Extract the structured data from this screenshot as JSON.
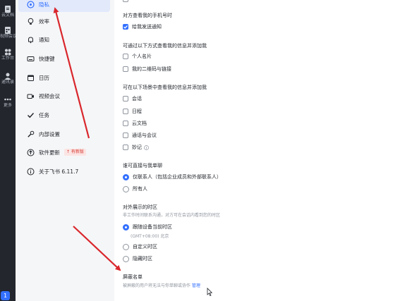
{
  "rail": {
    "items": [
      {
        "label": "云文档",
        "icon": "doc-icon"
      },
      {
        "label": "视频会议",
        "icon": "calendar-grid-icon"
      },
      {
        "label": "工作台",
        "icon": "apps-icon"
      },
      {
        "label": "通讯录",
        "icon": "contacts-icon"
      },
      {
        "label": "更多",
        "icon": "more-icon"
      }
    ],
    "badge": "1"
  },
  "nav": {
    "items": [
      {
        "label": "隐私",
        "icon": "shield-icon",
        "active": true
      },
      {
        "label": "效率",
        "icon": "bulb-icon"
      },
      {
        "label": "通知",
        "icon": "bell-icon"
      },
      {
        "label": "快捷键",
        "icon": "keyboard-icon"
      },
      {
        "label": "日历",
        "icon": "calendar-icon"
      },
      {
        "label": "视频会议",
        "icon": "video-icon"
      },
      {
        "label": "任务",
        "icon": "check-icon"
      },
      {
        "label": "内部设置",
        "icon": "wrench-icon"
      },
      {
        "label": "软件更新",
        "icon": "upload-icon",
        "badge": "↑ 有新版"
      },
      {
        "label": "关于飞书 6.11.7",
        "icon": "info-icon"
      }
    ]
  },
  "privacy": {
    "phone": {
      "title": "对方查看我的手机号时",
      "options": [
        {
          "label": "给我发送通知",
          "checked": true
        }
      ]
    },
    "find": {
      "title": "可通过以下方式查看我的信息并添加我",
      "options": [
        {
          "label": "个人名片",
          "checked": false
        },
        {
          "label": "我的二维码与链接",
          "checked": false
        }
      ]
    },
    "scenes": {
      "title": "可在以下场景中查看我的信息并添加我",
      "options": [
        {
          "label": "会话",
          "checked": false
        },
        {
          "label": "日程",
          "checked": false
        },
        {
          "label": "云文档",
          "checked": false
        },
        {
          "label": "通话与会议",
          "checked": false
        },
        {
          "label": "妙记",
          "checked": false
        }
      ]
    },
    "contact": {
      "title": "谁可直接与我单聊",
      "options": [
        {
          "label": "仅联系人（包括企业成员和外部联系人）",
          "checked": true
        },
        {
          "label": "所有人",
          "checked": false
        }
      ]
    },
    "timezone": {
      "title": "对外展示的时区",
      "subtitle": "非工作时间联系沟通，对方可在会话内看到您的时区",
      "options": [
        {
          "label": "跟随设备当前时区",
          "checked": true,
          "note": "(GMT+08:00) 北京"
        },
        {
          "label": "自定义时区",
          "checked": false
        },
        {
          "label": "隐藏时区",
          "checked": false
        }
      ]
    },
    "blocklist": {
      "title": "屏蔽名单",
      "subtitle": "被屏蔽的用户将无法与你单聊或协作",
      "link": "管理"
    }
  },
  "colors": {
    "accent": "#3370ff",
    "arrow": "#d9262c",
    "rail": "#23262d",
    "nav_bg": "#f5f6f7",
    "active_bg": "#e1e9fb"
  }
}
